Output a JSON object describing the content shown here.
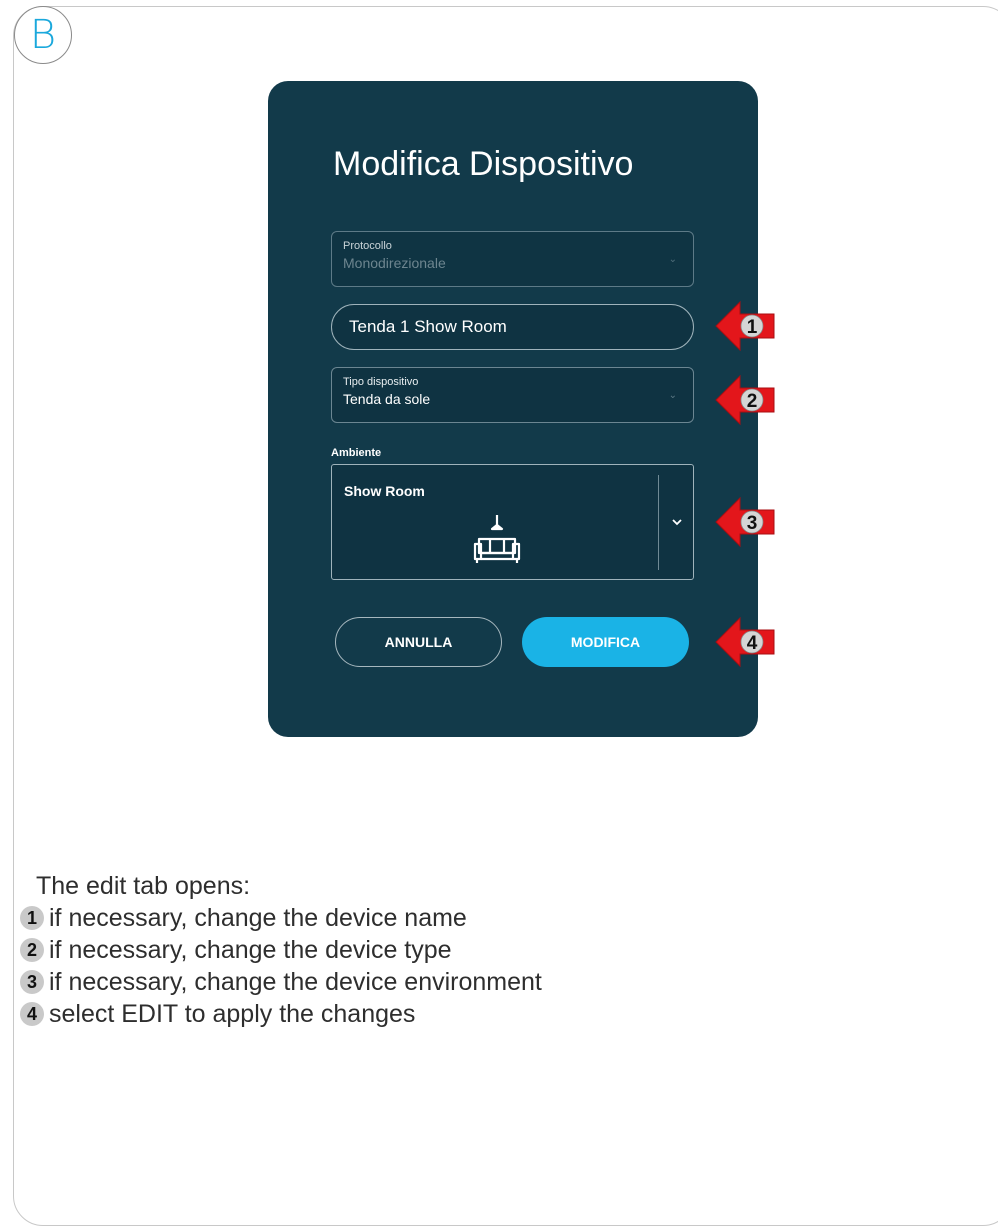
{
  "step_letter": "B",
  "dialog": {
    "title": "Modifica Dispositivo",
    "protocol": {
      "label": "Protocollo",
      "value": "Monodirezionale"
    },
    "name_input": {
      "value": "Tenda 1 Show Room"
    },
    "device_type": {
      "label": "Tipo dispositivo",
      "value": "Tenda da sole"
    },
    "environment": {
      "label": "Ambiente",
      "value": "Show Room",
      "icon": "sofa-lamp-icon"
    },
    "cancel_label": "ANNULLA",
    "confirm_label": "MODIFICA"
  },
  "callouts": [
    "1",
    "2",
    "3",
    "4"
  ],
  "instructions": {
    "intro": "The edit tab opens:",
    "steps": [
      {
        "num": "1",
        "text": "if necessary, change the device name"
      },
      {
        "num": "2",
        "text": "if necessary, change the device type"
      },
      {
        "num": "3",
        "text": "if necessary, change the device environment"
      },
      {
        "num": "4",
        "text": "select EDIT to apply the changes"
      }
    ]
  },
  "colors": {
    "panel": "#123a4a",
    "accent": "#1ab3e6",
    "arrow": "#e3161b",
    "letter": "#1aa8dc"
  }
}
